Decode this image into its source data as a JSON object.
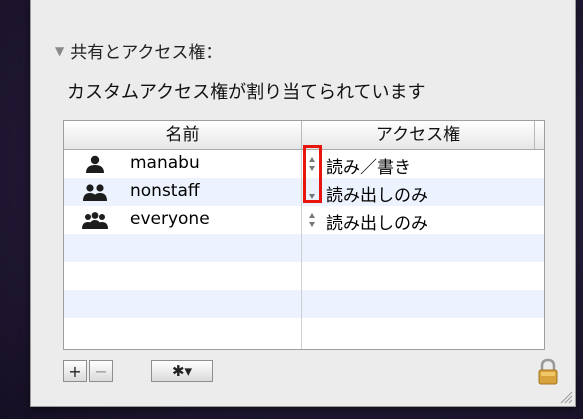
{
  "section": {
    "toggle_glyph": "▼",
    "title": "共有とアクセス権："
  },
  "description": "カスタムアクセス権が割り当てられています",
  "table": {
    "headers": {
      "name": "名前",
      "access": "アクセス権"
    },
    "rows": [
      {
        "icon": "single-user-icon",
        "name": "manabu",
        "permission": "読み／書き"
      },
      {
        "icon": "group-icon",
        "name": "nonstaff",
        "permission": "読み出しのみ"
      },
      {
        "icon": "everyone-icon",
        "name": "everyone",
        "permission": "読み出しのみ"
      }
    ]
  },
  "toolbar": {
    "add_label": "+",
    "remove_label": "−",
    "gear_label": "✱▾"
  },
  "colors": {
    "annotation": "#e8140e",
    "row_alt": "#edf3fe"
  }
}
